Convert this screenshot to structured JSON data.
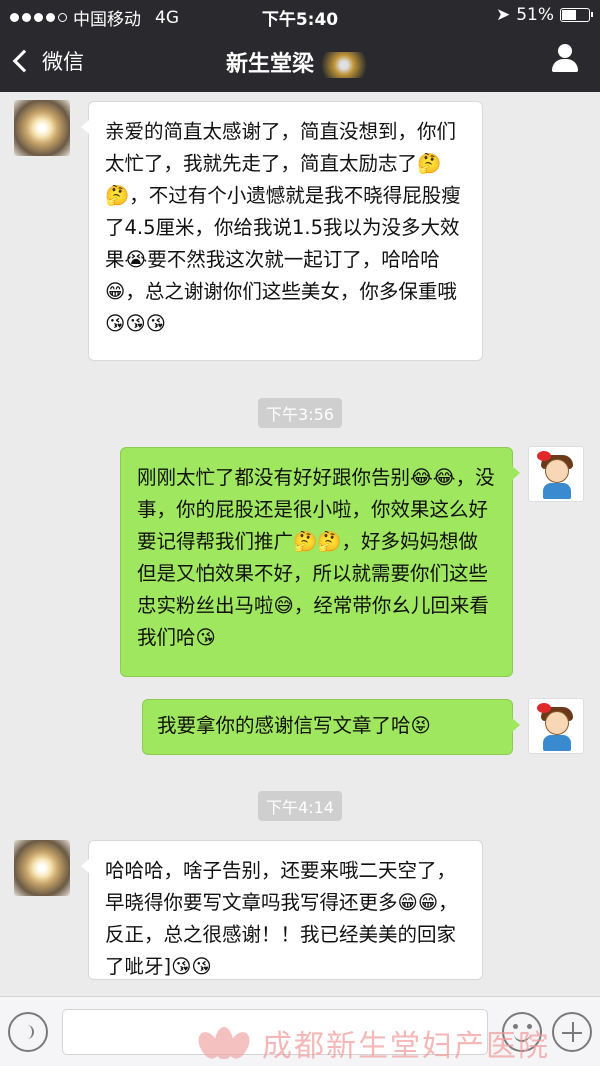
{
  "status_bar": {
    "carrier": "中国移动",
    "network": "4G",
    "time": "下午5:40",
    "battery": "51%"
  },
  "nav": {
    "back_label": "微信",
    "title": "新生堂梁"
  },
  "messages": [
    {
      "side": "in",
      "text": "亲爱的简直太感谢了，简直没想到，你们太忙了，我就先走了，简直太励志了🤔🤔，不过有个小遗憾就是我不晓得屁股瘦了4.5厘米，你给我说1.5我以为没多大效果😭要不然我这次就一起订了，哈哈哈😁，总之谢谢你们这些美女，你多保重哦😘😘😘"
    },
    {
      "timestamp": "下午3:56"
    },
    {
      "side": "out",
      "text": "刚刚太忙了都没有好好跟你告别😂😂，没事，你的屁股还是很小啦，你效果这么好要记得帮我们推广🤔🤔，好多妈妈想做但是又怕效果不好，所以就需要你们这些忠实粉丝出马啦😅，经常带你幺儿回来看我们哈😘"
    },
    {
      "side": "out",
      "text": "我要拿你的感谢信写文章了哈😝"
    },
    {
      "timestamp": "下午4:14"
    },
    {
      "side": "in",
      "text": "哈哈哈，啥子告别，还要来哦二天空了，早晓得你要写文章吗我写得还更多😁😁，反正，总之很感谢！！我已经美美的回家了呲牙]😘😘"
    }
  ],
  "watermark": "成都新生堂妇产医院"
}
